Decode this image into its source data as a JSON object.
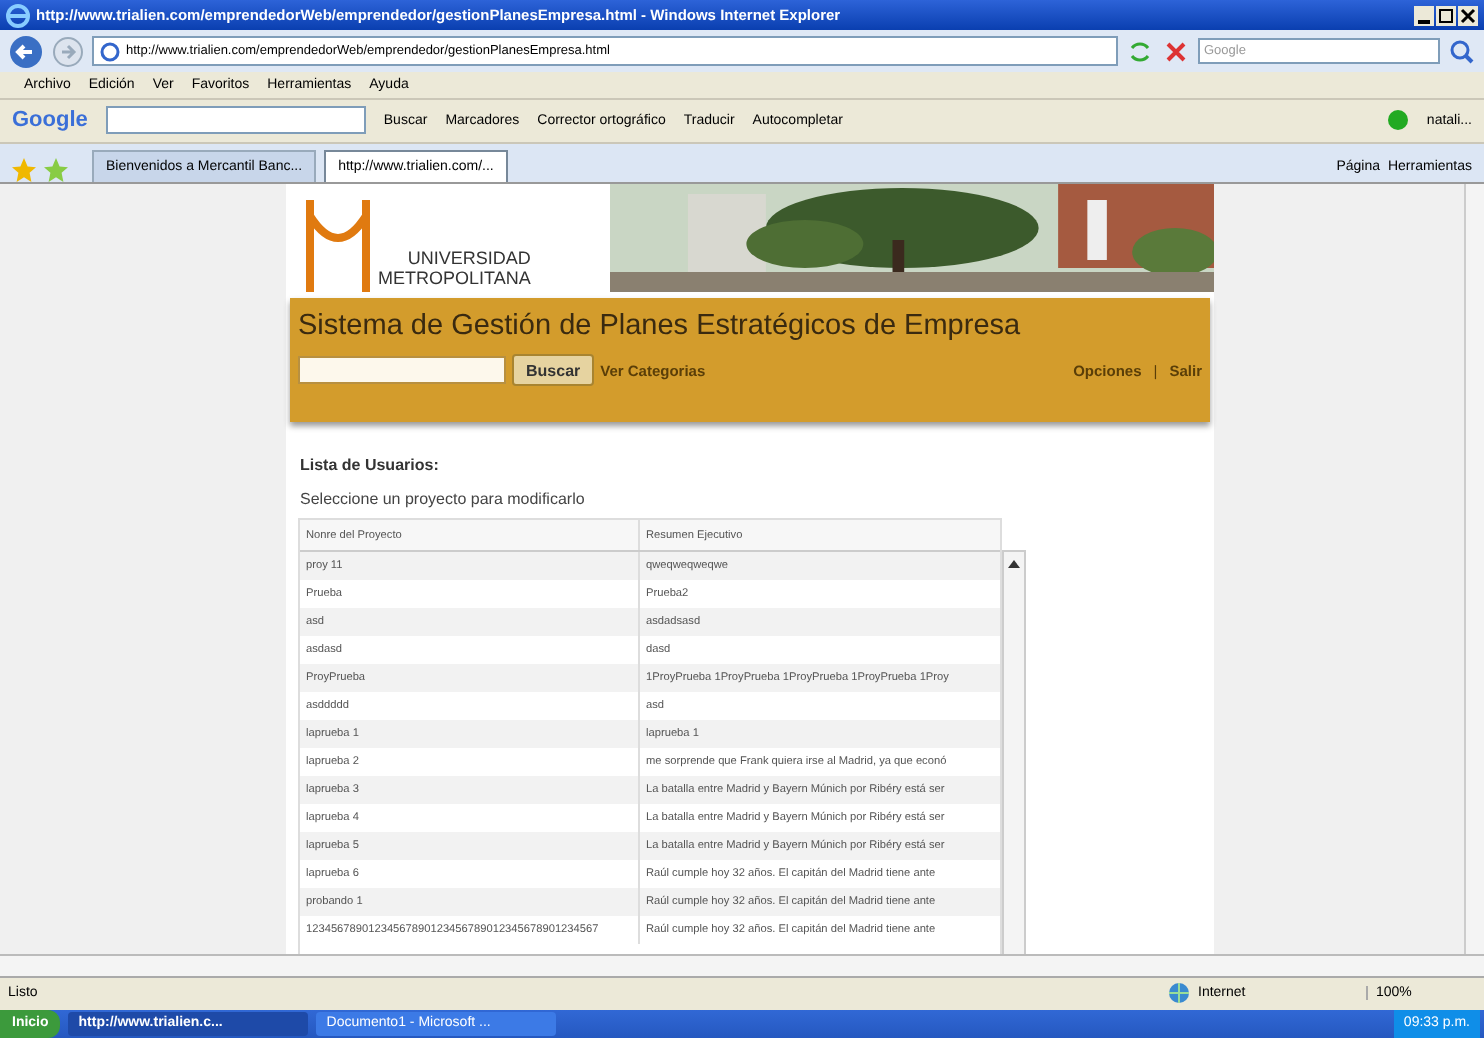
{
  "window": {
    "title": "http://www.trialien.com/emprendedorWeb/emprendedor/gestionPlanesEmpresa.html - Windows Internet Explorer"
  },
  "address_bar": {
    "url": "http://www.trialien.com/emprendedorWeb/emprendedor/gestionPlanesEmpresa.html",
    "search_placeholder": "Google"
  },
  "menu": [
    "Archivo",
    "Edición",
    "Ver",
    "Favoritos",
    "Herramientas",
    "Ayuda"
  ],
  "google_toolbar": {
    "logo": "Google",
    "items": [
      "Buscar",
      "Marcadores",
      "Corrector ortográfico",
      "Traducir",
      "Autocompletar"
    ],
    "user": "natali..."
  },
  "tabs": [
    {
      "label": "Bienvenidos a Mercantil Banc...",
      "selected": false
    },
    {
      "label": "http://www.trialien.com/...",
      "selected": true
    }
  ],
  "command_bar": [
    "Página",
    "Herramientas"
  ],
  "page": {
    "logo_lines": [
      "UNIVERSIDAD",
      "METROPOLITANA"
    ],
    "header_title": "Sistema de Gestión de Planes Estratégicos de Empresa",
    "search_button": "Buscar",
    "left_link": "Ver Categorias",
    "right_links": [
      "Opciones",
      "|",
      "Salir"
    ],
    "section_title": "Lista de Usuarios:",
    "instruction": "Seleccione un proyecto para modificarlo",
    "table": {
      "columns": [
        "Nonre del Proyecto",
        "Resumen Ejecutivo"
      ],
      "rows": [
        [
          "proy 11",
          "qweqweqweqwe"
        ],
        [
          "Prueba",
          "Prueba2"
        ],
        [
          "asd",
          "asdadsasd"
        ],
        [
          "asdasd",
          "dasd"
        ],
        [
          "ProyPrueba",
          "1ProyPrueba 1ProyPrueba 1ProyPrueba 1ProyPrueba 1Proy"
        ],
        [
          "asddddd",
          "asd"
        ],
        [
          "laprueba 1",
          "laprueba 1"
        ],
        [
          "laprueba 2",
          "me sorprende que Frank quiera irse al Madrid, ya que econó"
        ],
        [
          "laprueba 3",
          "La batalla entre Madrid y Bayern Múnich por Ribéry está ser"
        ],
        [
          "laprueba 4",
          "La batalla entre Madrid y Bayern Múnich por Ribéry está ser"
        ],
        [
          "laprueba 5",
          "La batalla entre Madrid y Bayern Múnich por Ribéry está ser"
        ],
        [
          "laprueba 6",
          "Raúl cumple hoy 32 años. El capitán del Madrid tiene ante"
        ],
        [
          "probando 1",
          "Raúl cumple hoy 32 años. El capitán del Madrid tiene ante"
        ],
        [
          "12345678901234567890123456789012345678901234567",
          "Raúl cumple hoy 32 años. El capitán del Madrid tiene ante"
        ]
      ]
    }
  },
  "status_bar": {
    "text": "Listo",
    "zone": "Internet",
    "zoom": "100%"
  },
  "taskbar": {
    "start": "Inicio",
    "items": [
      {
        "label": "http://www.trialien.c...",
        "selected": true
      },
      {
        "label": "Documento1 - Microsoft ...",
        "selected": false
      }
    ],
    "clock": "09:33 p.m."
  }
}
